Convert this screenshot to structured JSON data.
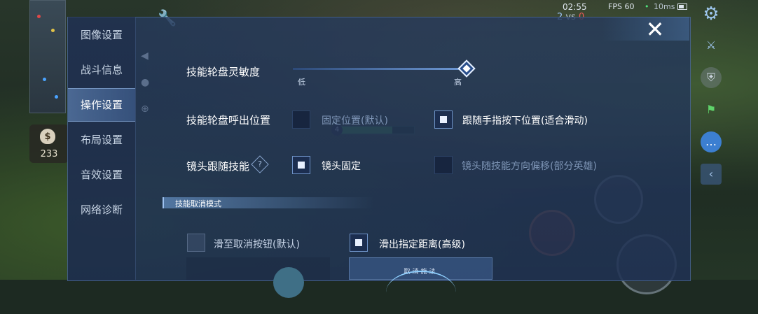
{
  "hud": {
    "time": "02:55",
    "fps": "FPS 60",
    "latency": "10ms",
    "score_blue": "2",
    "score_vs": "vs",
    "score_red": "0",
    "gold": "233",
    "gold_icon_symbol": "$",
    "hero_level": "4"
  },
  "nav": {
    "items": [
      {
        "label": "图像设置"
      },
      {
        "label": "战斗信息"
      },
      {
        "label": "操作设置"
      },
      {
        "label": "布局设置"
      },
      {
        "label": "音效设置"
      },
      {
        "label": "网络诊断"
      }
    ],
    "active_index": 2
  },
  "settings": {
    "wheel_sensitivity": {
      "label": "技能轮盘灵敏度",
      "low_label": "低",
      "high_label": "高",
      "value_fraction": 1.0
    },
    "wheel_position": {
      "label": "技能轮盘呼出位置",
      "option_fixed": "固定位置(默认)",
      "option_follow": "跟随手指按下位置(适合滑动)",
      "selected": "follow"
    },
    "camera_follow": {
      "label": "镜头跟随技能",
      "help_symbol": "?",
      "option_fixed": "镜头固定",
      "option_offset": "镜头随技能方向偏移(部分英雄)",
      "selected": "fixed"
    },
    "cancel_mode": {
      "section_title": "技能取消模式",
      "option_button": "滑至取消按钮(默认)",
      "option_distance": "滑出指定距离(高级)",
      "selected": "distance",
      "preview_text": "取消施法"
    }
  },
  "close_symbol": "✕",
  "colors": {
    "panel": "#263a5c",
    "accent": "#6e93c8",
    "active_tab": "#6e96cd",
    "text": "#ffffff",
    "dim_text": "#7e95b6",
    "net_good": "#4fe37c",
    "red_team": "#f05a5a"
  },
  "icons": [
    "gear-icon",
    "close-icon",
    "help-icon",
    "gold-bag-icon",
    "sword-icon",
    "shield-icon",
    "flag-icon",
    "chat-icon",
    "collapse-arrow-icon",
    "wrench-icon"
  ]
}
